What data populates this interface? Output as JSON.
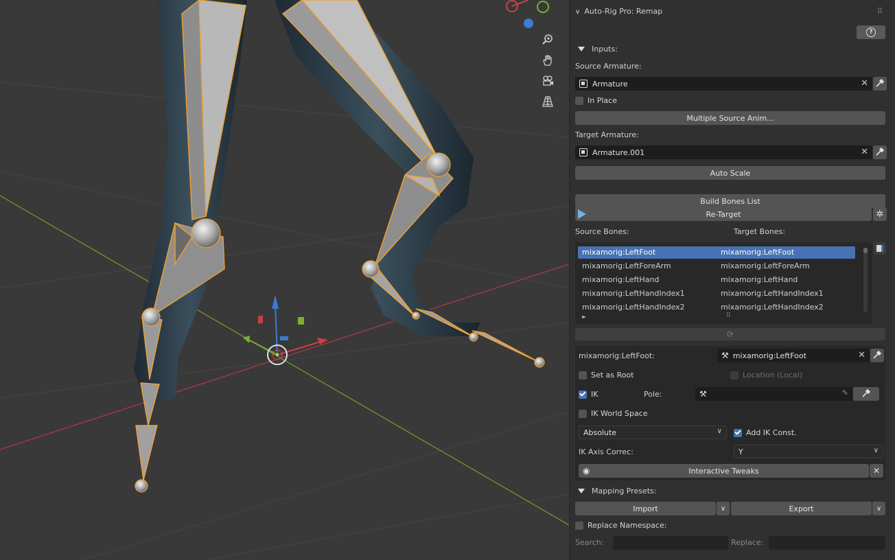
{
  "panel": {
    "title": "Auto-Rig Pro: Remap",
    "inputs_header": "Inputs:",
    "source_armature_label": "Source Armature:",
    "source_armature_value": "Armature",
    "in_place_label": "In Place",
    "multiple_source_button": "Multiple Source Anim...",
    "target_armature_label": "Target Armature:",
    "target_armature_value": "Armature.001",
    "auto_scale_button": "Auto Scale",
    "build_bones_button": "Build Bones List",
    "retarget_button": "Re-Target",
    "source_bones_label": "Source Bones:",
    "target_bones_label": "Target Bones:",
    "bones": [
      {
        "source": "mixamorig:LeftFoot",
        "target": "mixamorig:LeftFoot",
        "selected": true
      },
      {
        "source": "mixamorig:LeftForeArm",
        "target": "mixamorig:LeftForeArm",
        "selected": false
      },
      {
        "source": "mixamorig:LeftHand",
        "target": "mixamorig:LeftHand",
        "selected": false
      },
      {
        "source": "mixamorig:LeftHandIndex1",
        "target": "mixamorig:LeftHandIndex1",
        "selected": false
      },
      {
        "source": "mixamorig:LeftHandIndex2",
        "target": "mixamorig:LeftHandIndex2",
        "selected": false
      }
    ],
    "bone_detail": {
      "source_label": "mixamorig:LeftFoot:",
      "target_value": "mixamorig:LeftFoot",
      "set_as_root_label": "Set as Root",
      "location_local_label": "Location (Local)",
      "ik_label": "IK",
      "pole_label": "Pole:",
      "ik_world_space_label": "IK World Space",
      "mode_value": "Absolute",
      "add_ik_const_label": "Add IK Const.",
      "ik_axis_label": "IK Axis Correc:",
      "ik_axis_value": "Y",
      "interactive_tweaks_button": "Interactive Tweaks"
    },
    "mapping_presets_header": "Mapping Presets:",
    "import_button": "Import",
    "export_button": "Export",
    "replace_namespace_label": "Replace Namespace:",
    "search_label": "Search:",
    "replace_label": "Replace:"
  },
  "colors": {
    "accent_blue": "#4772b3",
    "bone_outline": "#f0a030",
    "axis_x": "#c8404a",
    "axis_y": "#7ab030",
    "axis_z": "#3a7bd5"
  },
  "icons": [
    "zoom-icon",
    "hand-pan-icon",
    "camera-icon",
    "grid-perspective-icon",
    "eyedropper-icon",
    "question-icon",
    "play-icon",
    "gear-icon",
    "bone-icon",
    "eye-icon",
    "refresh-icon"
  ]
}
